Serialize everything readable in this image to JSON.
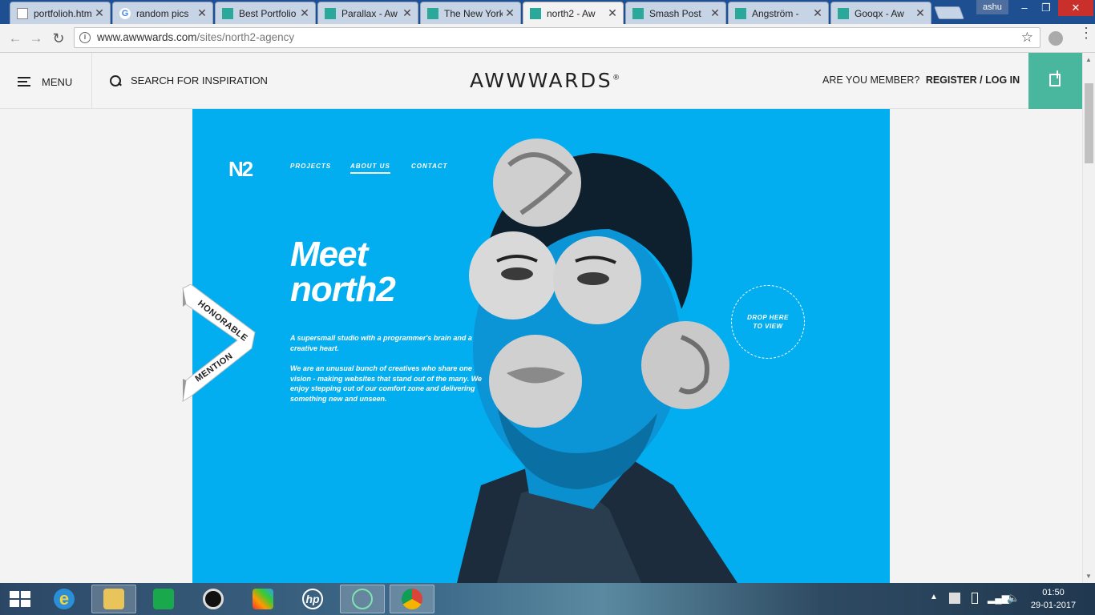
{
  "browser": {
    "tabs": [
      {
        "title": "portfolioh.html",
        "favicon": "document-icon",
        "active": false
      },
      {
        "title": "random pics",
        "favicon": "google-icon",
        "active": false
      },
      {
        "title": "Best Portfolio",
        "favicon": "awwwards-icon",
        "active": false
      },
      {
        "title": "Parallax - Aw",
        "favicon": "awwwards-icon",
        "active": false
      },
      {
        "title": "The New York",
        "favicon": "awwwards-icon",
        "active": false
      },
      {
        "title": "north2 - Aw",
        "favicon": "awwwards-icon",
        "active": true
      },
      {
        "title": "Smash Post",
        "favicon": "awwwards-icon",
        "active": false
      },
      {
        "title": "Angström -",
        "favicon": "awwwards-icon",
        "active": false
      },
      {
        "title": "Gooqx - Aw",
        "favicon": "awwwards-icon",
        "active": false
      }
    ],
    "user": "ashu",
    "url_host": "www.awwwards.com",
    "url_path": "/sites/north2-agency",
    "window_controls": {
      "minimize": "–",
      "restore": "❐",
      "close": "✕"
    }
  },
  "awwwards": {
    "menu_label": "MENU",
    "search_label": "SEARCH FOR INSPIRATION",
    "logo": "AWWWARDS",
    "logo_mark": "®",
    "member_prompt": "ARE YOU MEMBER?",
    "register_login": "REGISTER / LOG IN",
    "accent_color": "#49b79d"
  },
  "site_preview": {
    "logo": "N2",
    "nav": [
      "PROJECTS",
      "ABOUT US",
      "CONTACT"
    ],
    "active_nav": "ABOUT US",
    "title_line1": "Meet",
    "title_line2": "north2",
    "tagline": "A supersmall studio with a programmer's brain and a creative heart.",
    "description": "We are an unusual bunch of creatives who share one vision - making websites that stand out of the many. We enjoy stepping out of our comfort zone and delivering something new and unseen.",
    "drop_label_1": "DROP HERE",
    "drop_label_2": "TO VIEW",
    "background_color": "#02aef0"
  },
  "ribbon": {
    "line1": "HONORABLE",
    "line2": "MENTION"
  },
  "taskbar": {
    "items": [
      "ie-icon",
      "file-explorer-icon",
      "store-icon",
      "media-icon",
      "paint-icon",
      "hp-icon",
      "atom-icon",
      "chrome-icon"
    ],
    "time": "01:50",
    "date": "29-01-2017"
  }
}
